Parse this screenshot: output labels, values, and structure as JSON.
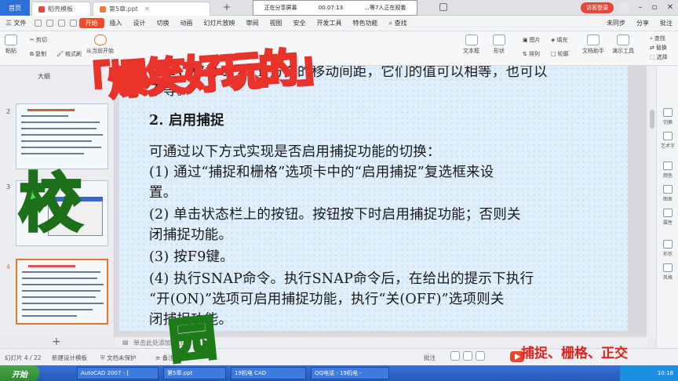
{
  "tabs": [
    {
      "label": "首页"
    },
    {
      "label": "稻壳模板"
    },
    {
      "label": "第5章.ppt"
    }
  ],
  "share_bar": {
    "sharing": "正在分享屏幕",
    "time": "00:07:13",
    "viewers": "...等7人正在观看"
  },
  "visitor_button": "访客登录",
  "menu": {
    "file": "三 文件",
    "items": [
      "开始",
      "插入",
      "设计",
      "切换",
      "动画",
      "幻灯片放映",
      "审阅",
      "视图",
      "安全",
      "开发工具",
      "特色功能"
    ],
    "search": "查找",
    "right": [
      "未同步",
      "分享",
      "批注"
    ]
  },
  "toolbar": {
    "cut": "剪切",
    "copy": "复制",
    "paste": "粘贴",
    "format_painter": "格式刷",
    "play_from_current": "从当前开始",
    "textbox": "文本框",
    "shape": "形状",
    "arrange": "排列",
    "picture": "图片",
    "fill": "填充",
    "outline": "轮廓",
    "doc_helper": "文档助手",
    "presenter_tools": "演示工具",
    "find": "查找",
    "replace": "替换",
    "select": "选择"
  },
  "left_pane": {
    "outline_tab": "大纲",
    "slides": [
      {
        "num": "2"
      },
      {
        "num": "3"
      },
      {
        "num": "4"
      }
    ]
  },
  "slide": {
    "lines": [
      "移量，称为 X 和 Y 方向的移动间距，它们的值可以相等，也可以",
      "不等。",
      "2. 启用捕捉",
      "可通过以下方式实现是否启用捕捉功能的切换：",
      "(1) 通过“捕捉和栅格”选项卡中的“启用捕捉”复选框来设",
      "置。",
      "(2) 单击状态栏上的按钮。按钮按下时启用捕捉功能；否则关",
      "闭捕捉功能。",
      "(3) 按F9键。",
      "(4) 执行SNAP命令。执行SNAP命令后，在给出的提示下执行",
      "“开(ON)”选项可启用捕捉功能，执行“关(OFF)”选项则关",
      "闭捕捉功能。"
    ]
  },
  "notes_placeholder": "单击此处添加备注",
  "right_sidebar": [
    "切换",
    "艺术字",
    "颜色",
    "图表",
    "属性",
    "形状",
    "风格"
  ],
  "status": {
    "slide_count": "幻灯片 4 / 22",
    "design_template": "新建设计模板",
    "doc_protected": "文档未保护",
    "notes": "备注",
    "comments": "批注"
  },
  "taskbar": {
    "start": "开始",
    "items": [
      "AutoCAD 2007 - [",
      "第5章.ppt",
      "19机电   CAD",
      "QQ电话 - 19机电 -"
    ],
    "time": "10:18"
  },
  "overlays": {
    "banner": "「爆笑好玩的」",
    "xiao": "校",
    "yuan": "园",
    "caption": "捕捉、栅格、正交"
  }
}
